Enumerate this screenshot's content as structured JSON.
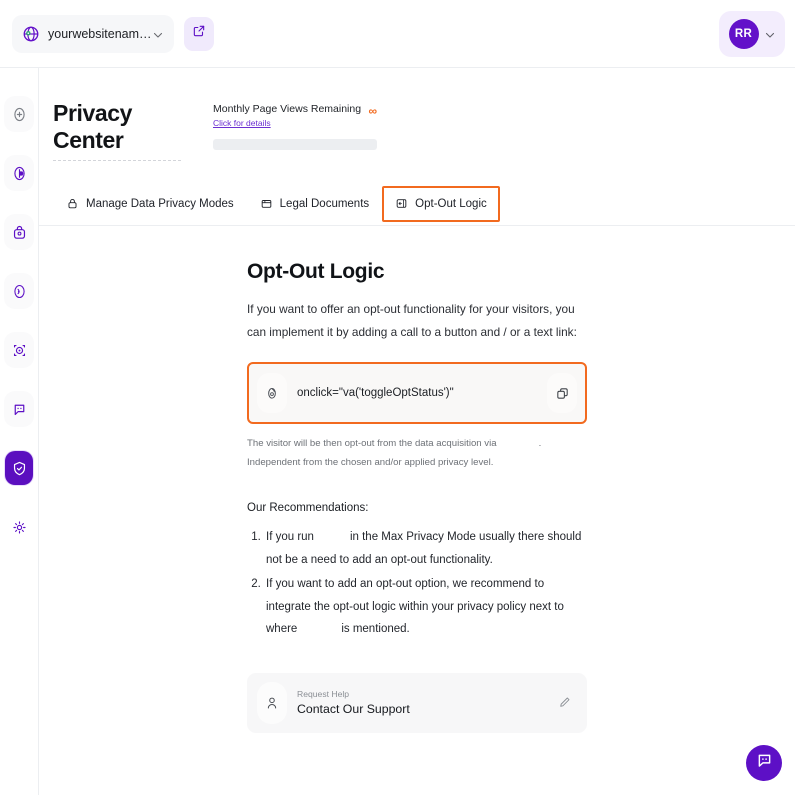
{
  "topbar": {
    "site_name": "yourwebsitename.co",
    "globe_icon": "globe-icon",
    "chevron_icon": "chevron-down-icon",
    "open_external_icon": "external-link-icon",
    "avatar_initials": "RR",
    "account_chevron_icon": "chevron-down-icon"
  },
  "rail": {
    "items": [
      {
        "icon": "add-circle-icon",
        "active": false
      },
      {
        "icon": "pie-chart-icon",
        "active": false
      },
      {
        "icon": "shopping-bag-icon",
        "active": false
      },
      {
        "icon": "signal-icon",
        "active": false
      },
      {
        "icon": "target-scan-icon",
        "active": false
      },
      {
        "icon": "chat-bubble-icon",
        "active": false
      },
      {
        "icon": "shield-check-icon",
        "active": true
      },
      {
        "icon": "gear-icon",
        "active": false
      }
    ]
  },
  "header": {
    "title": "Privacy Center",
    "quota_label": "Monthly Page Views Remaining",
    "quota_link": "Click for details",
    "quota_value": "∞"
  },
  "tabs": [
    {
      "label": "Manage Data Privacy Modes",
      "icon": "lock-icon",
      "highlighted": false
    },
    {
      "label": "Legal Documents",
      "icon": "folder-icon",
      "highlighted": false
    },
    {
      "label": "Opt-Out Logic",
      "icon": "panel-left-icon",
      "highlighted": true
    }
  ],
  "main": {
    "heading": "Opt-Out Logic",
    "lead": "If you want to offer an opt-out functionality for your visitors, you can implement it by adding a call to a button and / or a text link:",
    "code_snippet": "onclick=\"va('toggleOptStatus')\"",
    "code_icon": "code-icon",
    "copy_icon": "copy-icon",
    "caption_part1": "The visitor will be then opt-out from the data acquisition via",
    "caption_part2": ". Independent from the chosen and/or applied privacy level.",
    "recommendations_title": "Our Recommendations:",
    "recommendations": [
      {
        "before": "If you run",
        "after": "in the Max Privacy Mode usually there should not be a need to add an opt-out functionality."
      },
      {
        "before": "If you want to add an opt-out option, we recommend to integrate the opt-out logic within your privacy policy next to where",
        "after": "is mentioned."
      }
    ],
    "support": {
      "icon": "person-icon",
      "small_label": "Request Help",
      "big_label": "Contact Our Support",
      "edit_icon": "pencil-icon"
    }
  },
  "fab": {
    "icon": "chat-support-icon"
  },
  "colors": {
    "brand_purple": "#5d10c6",
    "accent_orange": "#f26a1f",
    "link_purple": "#6b2fd1",
    "rail_active_bg": "#e8dcfb"
  }
}
